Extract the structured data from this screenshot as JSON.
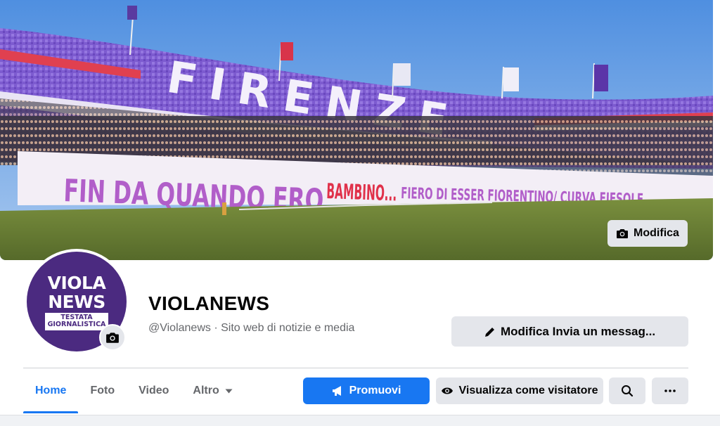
{
  "cover": {
    "banner_text": "FIN DA QUANDO ERO",
    "banner_text_red": "BAMBINO...",
    "banner_text_end": "FIERO DI ESSER FIORENTINO/  CURVA FIESOLE",
    "choreo_text": "FIRENZE",
    "edit_label": "Modifica"
  },
  "profile": {
    "name": "VIOLANEWS",
    "subtitle": "@Violanews · Sito web di notizie e media",
    "avatar": {
      "line1": "VIOLA",
      "line2": "NEWS",
      "tag_line1": "TESTATA",
      "tag_line2": "GIORNALISTICA"
    },
    "message_button": "Modifica Invia un messag..."
  },
  "tabs": [
    {
      "label": "Home",
      "active": true
    },
    {
      "label": "Foto",
      "active": false
    },
    {
      "label": "Video",
      "active": false
    },
    {
      "label": "Altro",
      "active": false
    }
  ],
  "actions": {
    "promote": "Promuovi",
    "visitor": "Visualizza come visitatore"
  },
  "colors": {
    "brand_blue": "#1877f2",
    "viola": "#4b2a80",
    "button_gray": "#e4e6eb"
  },
  "icons": {
    "cover_edit": "camera-icon",
    "avatar_edit": "camera-icon",
    "message": "pencil-icon",
    "promote": "megaphone-icon",
    "visitor": "eye-icon",
    "search": "search-icon",
    "more": "more-icon",
    "altro": "caret-down-icon"
  }
}
